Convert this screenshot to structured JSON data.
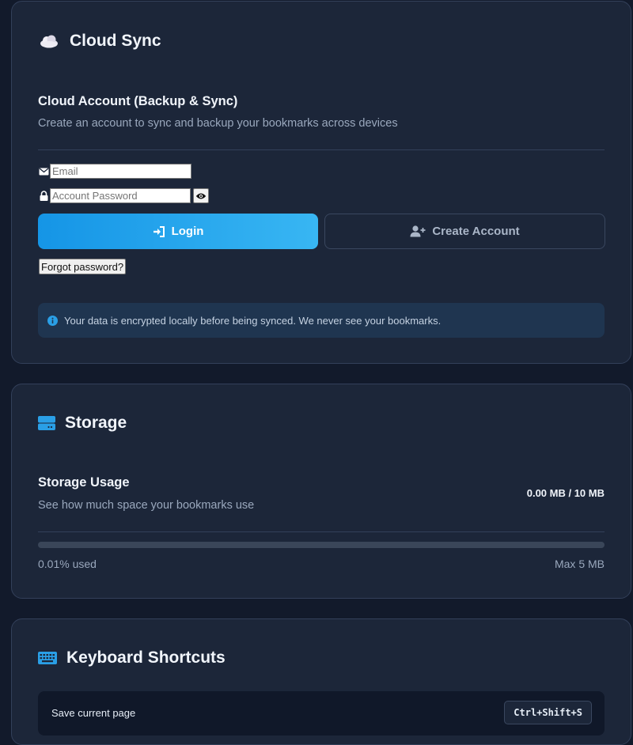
{
  "cloud_sync": {
    "title": "Cloud Sync",
    "icon": "cloud-icon",
    "account_title": "Cloud Account (Backup & Sync)",
    "account_subtitle": "Create an account to sync and backup your bookmarks across devices",
    "email_placeholder": "Email",
    "email_value": "",
    "password_placeholder": "Account Password",
    "password_value": "",
    "login_label": "Login",
    "create_account_label": "Create Account",
    "forgot_password_label": "Forgot password?",
    "notice_text": "Your data is encrypted locally before being synced. We never see your bookmarks."
  },
  "storage": {
    "title": "Storage",
    "icon": "storage-icon",
    "usage_title": "Storage Usage",
    "usage_subtitle": "See how much space your bookmarks use",
    "usage_value": "0.00 MB / 10 MB",
    "used_percent": 0.01,
    "used_label": "0.01% used",
    "max_label": "Max 5 MB"
  },
  "keyboard_shortcuts": {
    "title": "Keyboard Shortcuts",
    "icon": "keyboard-icon",
    "items": [
      {
        "label": "Save current page",
        "keys": "Ctrl+Shift+S"
      }
    ]
  },
  "colors": {
    "accent": "#1e9be8",
    "card_background": "#1c2639",
    "page_background": "#121a2b",
    "notice_background": "#1f3550"
  }
}
